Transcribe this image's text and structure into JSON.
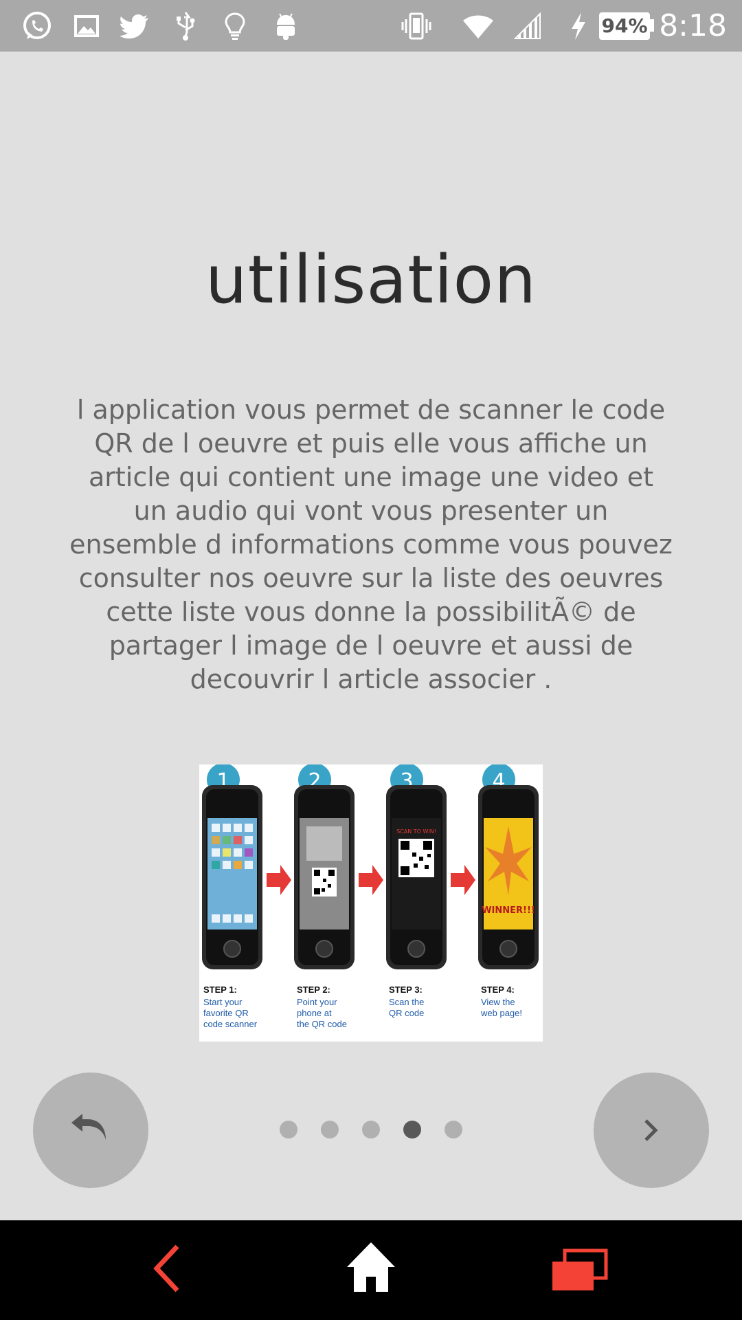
{
  "status_bar": {
    "left_icons": [
      "whatsapp-icon",
      "image-icon",
      "twitter-icon",
      "usb-icon",
      "lightbulb-icon",
      "android-icon"
    ],
    "right_icons": [
      "vibrate-icon",
      "wifi-icon",
      "signal-icon",
      "charging-icon"
    ],
    "battery": "94%",
    "time": "8:18"
  },
  "page": {
    "title": "utilisation",
    "description": "l application vous permet de scanner le code QR de l oeuvre et puis elle vous affiche un article qui contient une image une video et un audio qui vont vous presenter un ensemble d informations comme vous pouvez consulter nos oeuvre sur la liste des oeuvres cette liste vous donne la possibilitÃ© de partager l image de l oeuvre et aussi de decouvrir l article associer ."
  },
  "illustration": {
    "steps": [
      {
        "number": "1",
        "label": "STEP 1:",
        "text": [
          "Start your",
          "favorite QR",
          "code scanner"
        ]
      },
      {
        "number": "2",
        "label": "STEP 2:",
        "text": [
          "Point your",
          "phone at",
          "the QR code"
        ]
      },
      {
        "number": "3",
        "label": "STEP 3:",
        "text": [
          "Scan the",
          "QR code"
        ],
        "screen_text": "SCAN TO WIN!"
      },
      {
        "number": "4",
        "label": "STEP 4:",
        "text": [
          "View the",
          "web page!"
        ],
        "screen_text": "WINNER!!!"
      }
    ]
  },
  "controls": {
    "back_icon": "undo-icon",
    "next_icon": "chevron-right-icon",
    "page_count": 5,
    "active_page": 4
  },
  "nav_bar": {
    "icons": [
      "back-icon",
      "home-icon",
      "recents-icon"
    ],
    "accent_color": "#f44336"
  },
  "colors": {
    "background": "#e0e0e0",
    "status_bar": "#a9a9a9",
    "title": "#2b2b2b",
    "body_text": "#666666",
    "fab": "#b4b4b4",
    "dot": "#b0b0b0",
    "dot_active": "#595959",
    "step_badge": "#3aa4c8",
    "arrow": "#e53935"
  }
}
